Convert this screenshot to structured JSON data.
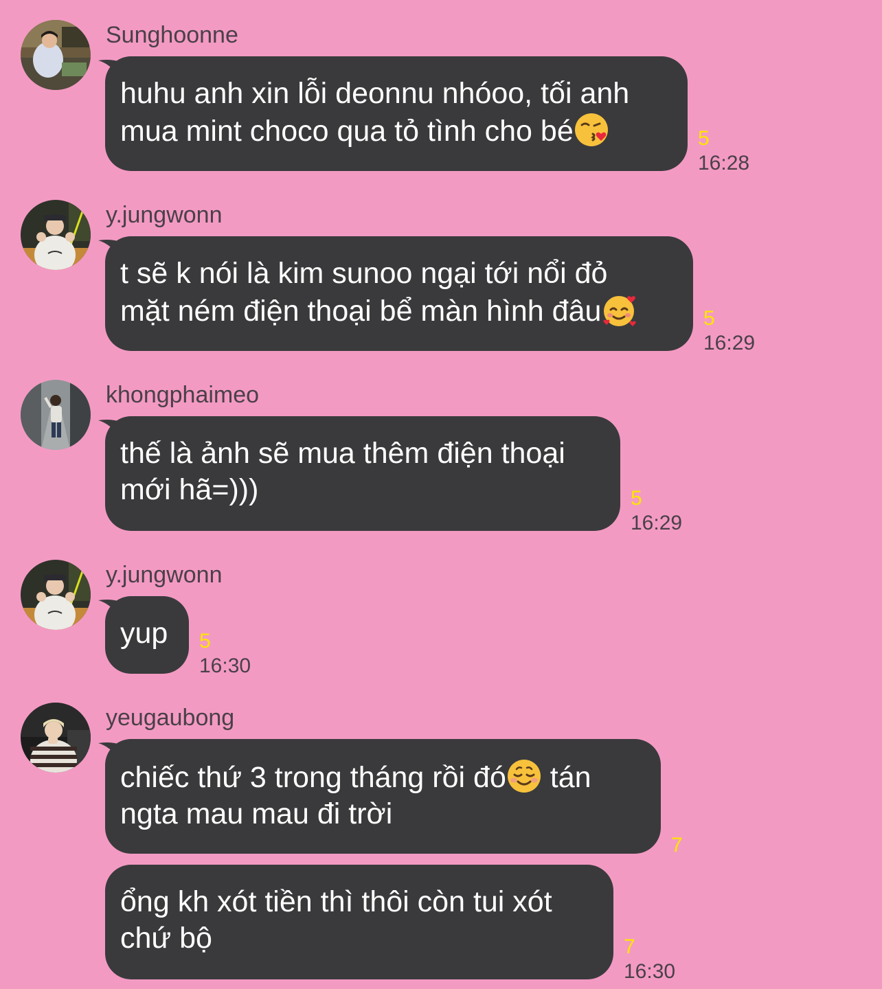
{
  "messages": [
    {
      "sender": "Sunghoonne",
      "line1": "huhu anh xin lỗi deonnu nhóoo, tối anh",
      "line2": "mua mint choco qua tỏ tình cho bé",
      "emoji": "face-blowing-kiss-emoji",
      "read_count": "5",
      "time": "16:28"
    },
    {
      "sender": "y.jungwonn",
      "line1": "t sẽ k nói là kim sunoo ngại tới nổi đỏ",
      "line2": "mặt ném điện thoại bể màn hình đâu",
      "emoji": "smiling-face-with-hearts-emoji",
      "read_count": "5",
      "time": "16:29"
    },
    {
      "sender": "khongphaimeo",
      "line1": "thế là ảnh sẽ mua thêm điện thoại",
      "line2": "mới hã=)))",
      "read_count": "5",
      "time": "16:29"
    },
    {
      "sender": "y.jungwonn",
      "line1": "yup",
      "read_count": "5",
      "time": "16:30"
    },
    {
      "sender": "yeugaubong",
      "line1_before": "chiếc thứ 3 trong tháng rồi đó",
      "line1_after": " tán",
      "line2": "ngta mau mau đi trời",
      "emoji": "smiling-face-emoji",
      "read_count": "7"
    },
    {
      "line1": "ổng kh xót tiền thì thôi còn tui xót",
      "line2": "chứ bộ",
      "read_count": "7",
      "time": "16:30"
    }
  ]
}
